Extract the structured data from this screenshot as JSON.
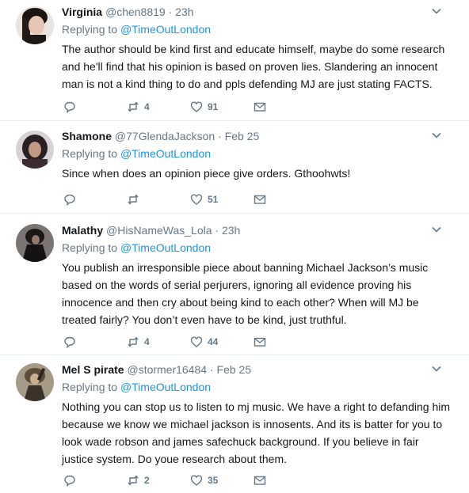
{
  "tweets": [
    {
      "username": "Virginia",
      "handle": "@chen8819",
      "separator": "·",
      "time": "23h",
      "reply_prefix": "Replying to",
      "reply_to": "@TimeOutLondon",
      "text": "The author should be kind first and educate himself, maybe do some research and he'll find that his opinion is based on proven lies. Slandering an innocent man is not a kind thing to do and ppls defending MJ are just stating FACTS.",
      "retweets": "4",
      "likes": "91"
    },
    {
      "username": "Shamone",
      "handle": "@77GlendaJackson",
      "separator": "·",
      "time": "Feb 25",
      "reply_prefix": "Replying to",
      "reply_to": "@TimeOutLondon",
      "text": "Since when does an opinion piece give orders.  Gthoohwts!",
      "retweets": "",
      "likes": "51"
    },
    {
      "username": "Malathy",
      "handle": "@HisNameWas_Lola",
      "separator": "·",
      "time": "23h",
      "reply_prefix": "Replying to",
      "reply_to": "@TimeOutLondon",
      "text": "You publish an irresponsible piece about banning Michael Jackson’s music based on the words of serial perjurers, ignoring all evidence proving his innocence and then cry about being kind to each other? When will MJ be treated fairly? You don’t even have to be kind, just truthful.",
      "retweets": "4",
      "likes": "44"
    },
    {
      "username": "Mel S pirate",
      "handle": "@stormer16484",
      "separator": "·",
      "time": "Feb 25",
      "reply_prefix": "Replying to",
      "reply_to": "@TimeOutLondon",
      "text": "Nothing you can stop us to listen to mj music. We have a right to defanding him because we know we michael jackson is innosents. And its is batter for you to look wade robson and james safechuck background. If you believe in fair justice system. Do youe research about them.",
      "retweets": "2",
      "likes": "35"
    }
  ],
  "icons": {
    "reply": "reply-icon",
    "retweet": "retweet-icon",
    "like": "heart-icon",
    "message": "envelope-icon",
    "more": "chevron-down-icon"
  },
  "colors": {
    "link": "#1b95e0",
    "secondary_text": "#657786",
    "divider": "#e6ecf0"
  }
}
